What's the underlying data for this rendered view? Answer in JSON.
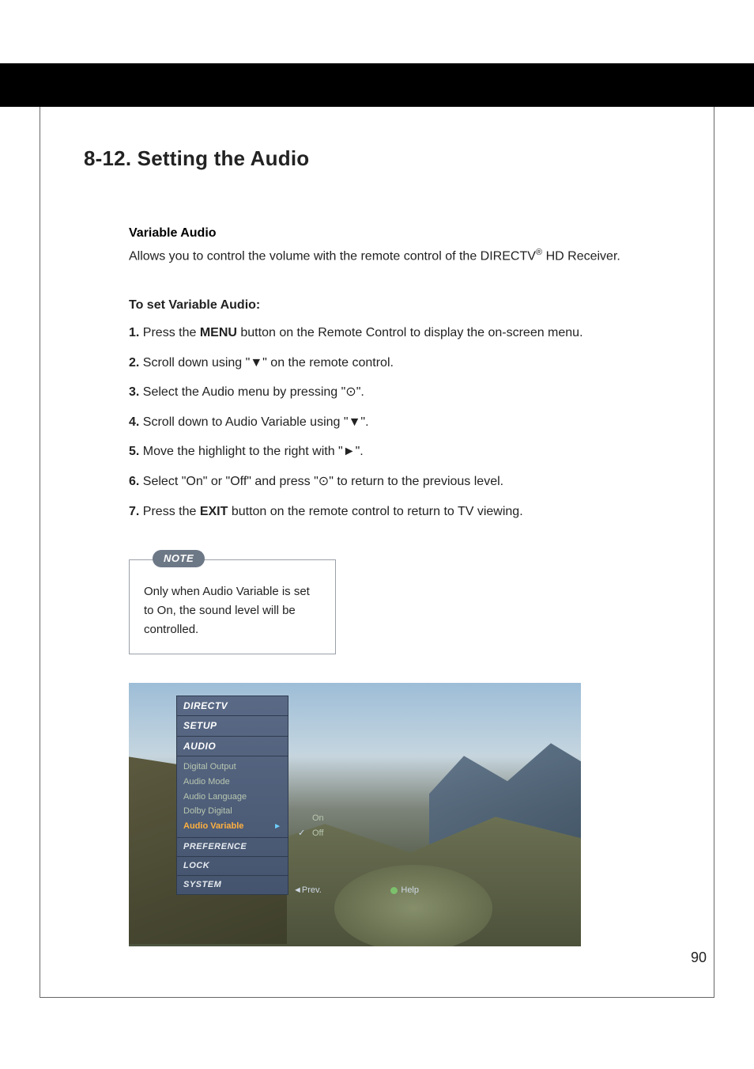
{
  "heading": "8-12. Setting the Audio",
  "variable_audio_title": "Variable Audio",
  "variable_audio_desc_pre": "Allows you to control the volume with the remote control of the DIRECTV",
  "variable_audio_desc_sup": "®",
  "variable_audio_desc_post": " HD Receiver.",
  "to_set_title": "To set Variable Audio:",
  "steps": [
    {
      "num": "1.",
      "pre": "Press the ",
      "bold": "MENU",
      "post": " button on the Remote Control to display the on-screen menu."
    },
    {
      "num": "2.",
      "pre": "Scroll down using \"",
      "sym": "▼",
      "post": "\" on the remote control."
    },
    {
      "num": "3.",
      "pre": "Select the Audio menu by pressing \"",
      "sym": "⊙",
      "post": "\"."
    },
    {
      "num": "4.",
      "pre": "Scroll down to Audio Variable using \"",
      "sym": "▼",
      "post": "\"."
    },
    {
      "num": "5.",
      "pre": "Move the highlight to the right with \"",
      "sym": "►",
      "post": "\"."
    },
    {
      "num": "6.",
      "pre": "Select \"On\" or \"Off\" and press \"",
      "sym": "⊙",
      "post": "\" to return to the previous level."
    },
    {
      "num": "7.",
      "pre": "Press the ",
      "bold": "EXIT",
      "post": " button on the remote control to return to TV viewing."
    }
  ],
  "note_label": "NOTE",
  "note_text": "Only when Audio Variable is set to On, the sound level will be controlled.",
  "osd": {
    "brand": "DIRECTV",
    "setup": "SETUP",
    "audio": "AUDIO",
    "items": [
      "Digital Output",
      "Audio Mode",
      "Audio Language",
      "Dolby Digital"
    ],
    "selected": "Audio Variable",
    "sections": [
      "PREFERENCE",
      "LOCK",
      "SYSTEM"
    ],
    "options": {
      "on": "On",
      "off": "Off"
    },
    "prev": "◄Prev.",
    "help": "Help"
  },
  "page_number": "90"
}
